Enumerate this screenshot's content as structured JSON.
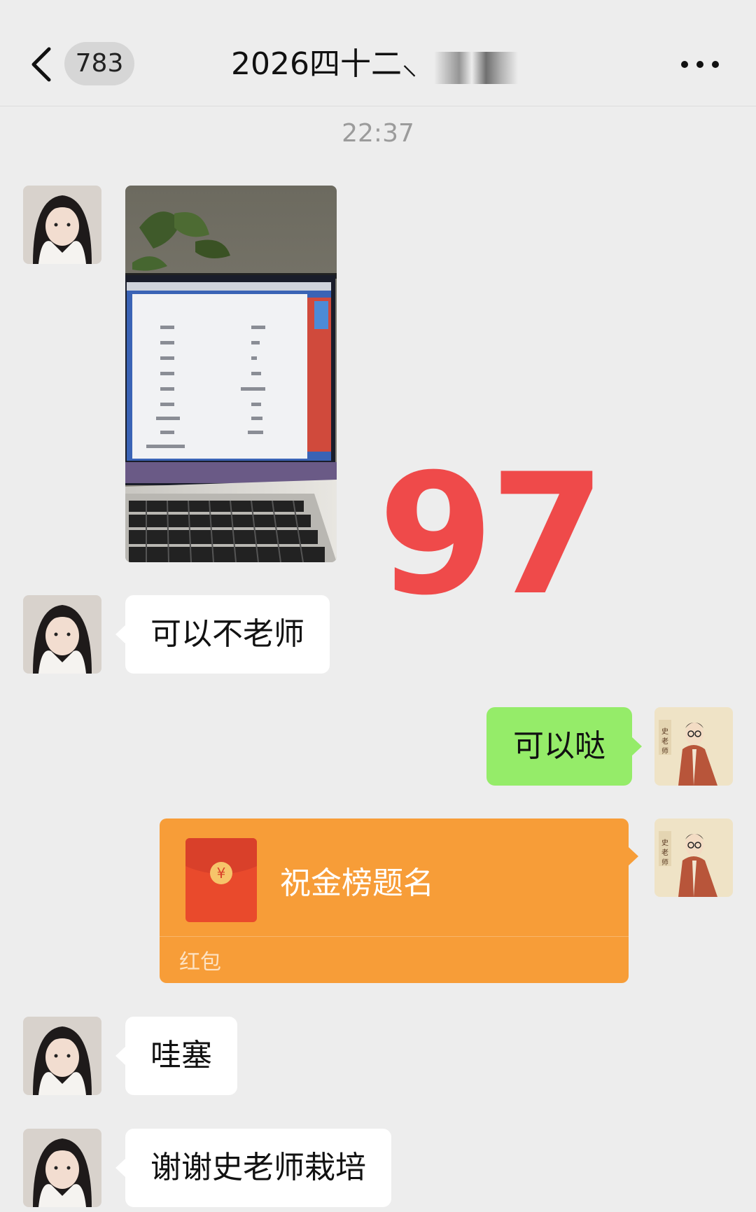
{
  "header": {
    "unread_count": "783",
    "title": "2026四十二⸜"
  },
  "chat": {
    "timestamp": "22:37",
    "messages": [
      {
        "side": "left",
        "type": "image"
      },
      {
        "side": "left",
        "type": "text",
        "text": "可以不老师"
      },
      {
        "side": "right",
        "type": "text",
        "text": "可以哒"
      },
      {
        "side": "right",
        "type": "red-packet",
        "text": "祝金榜题名",
        "packet_label": "红包"
      },
      {
        "side": "left",
        "type": "text",
        "text": "哇塞"
      },
      {
        "side": "left",
        "type": "text",
        "text": "谢谢史老师栽培"
      }
    ]
  },
  "overlay": {
    "score": "97",
    "score_color": "#ef4a4a"
  },
  "colors": {
    "background": "#ededed",
    "sent_bubble": "#95ec69",
    "red_packet": "#f79d38"
  },
  "icons": {
    "back": "chevron-left-icon",
    "more": "more-dots-icon",
    "packet": "yuan-coin-icon"
  }
}
